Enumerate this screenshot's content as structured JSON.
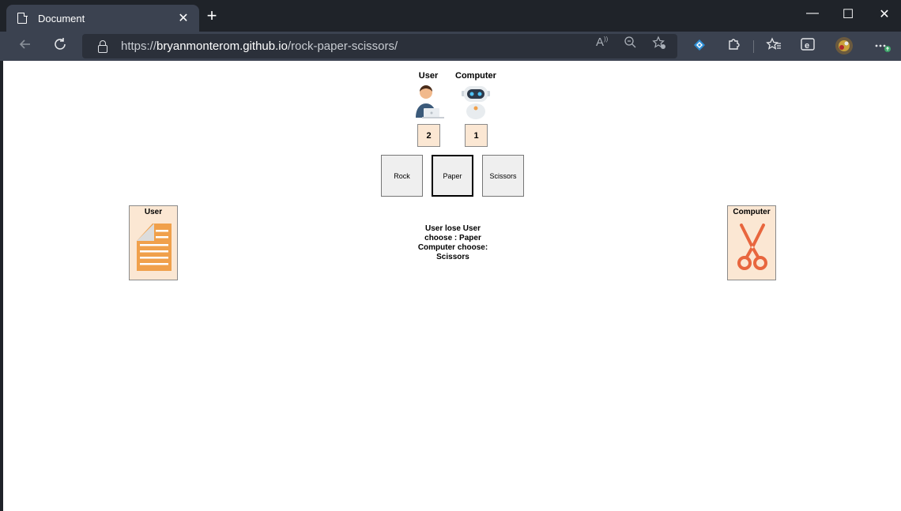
{
  "browser": {
    "tab_title": "Document",
    "tab_close": "✕",
    "new_tab": "+",
    "url_scheme": "https://",
    "url_host": "bryanmonterom.github.io",
    "url_path": "/rock-paper-scissors/",
    "minimize": "—",
    "maximize": "☐",
    "close": "✕"
  },
  "game": {
    "user_header": "User",
    "computer_header": "Computer",
    "user_score": "2",
    "computer_score": "1",
    "choices": [
      "Rock",
      "Paper",
      "Scissors"
    ],
    "selected_choice": "Paper",
    "user_card_title": "User",
    "computer_card_title": "Computer",
    "user_pick_icon": "paper-icon",
    "computer_pick_icon": "scissors-icon",
    "result_text": "User lose User choose : Paper Computer choose: Scissors"
  },
  "colors": {
    "score_bg": "#fbe7d3",
    "paper_color": "#f0a04b",
    "scissors_color": "#e8663e"
  }
}
